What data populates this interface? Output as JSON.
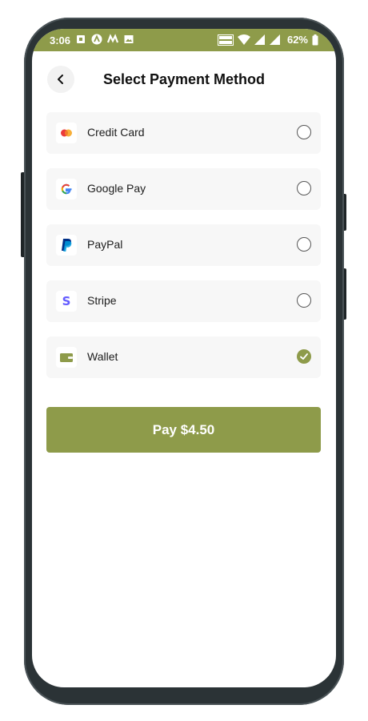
{
  "status_bar": {
    "time": "3:06",
    "battery_percent": "62%",
    "icons_left": [
      "sim-icon",
      "app-icon-a",
      "app-icon-m",
      "image-icon"
    ],
    "icons_right": [
      "volte-icon",
      "wifi-icon",
      "signal-icon",
      "signal-icon",
      "battery-icon"
    ],
    "color": "#8e9b4a"
  },
  "header": {
    "title": "Select Payment Method",
    "back_icon": "chevron-left-icon"
  },
  "methods": [
    {
      "label": "Credit Card",
      "icon": "mastercard-icon",
      "selected": false
    },
    {
      "label": "Google Pay",
      "icon": "google-icon",
      "selected": false
    },
    {
      "label": "PayPal",
      "icon": "paypal-icon",
      "selected": false
    },
    {
      "label": "Stripe",
      "icon": "stripe-icon",
      "selected": false
    },
    {
      "label": "Wallet",
      "icon": "wallet-icon",
      "selected": true
    }
  ],
  "pay_button": {
    "label": "Pay $4.50"
  },
  "colors": {
    "accent": "#8e9b4a",
    "item_background": "#f7f7f7",
    "text": "#111111"
  }
}
